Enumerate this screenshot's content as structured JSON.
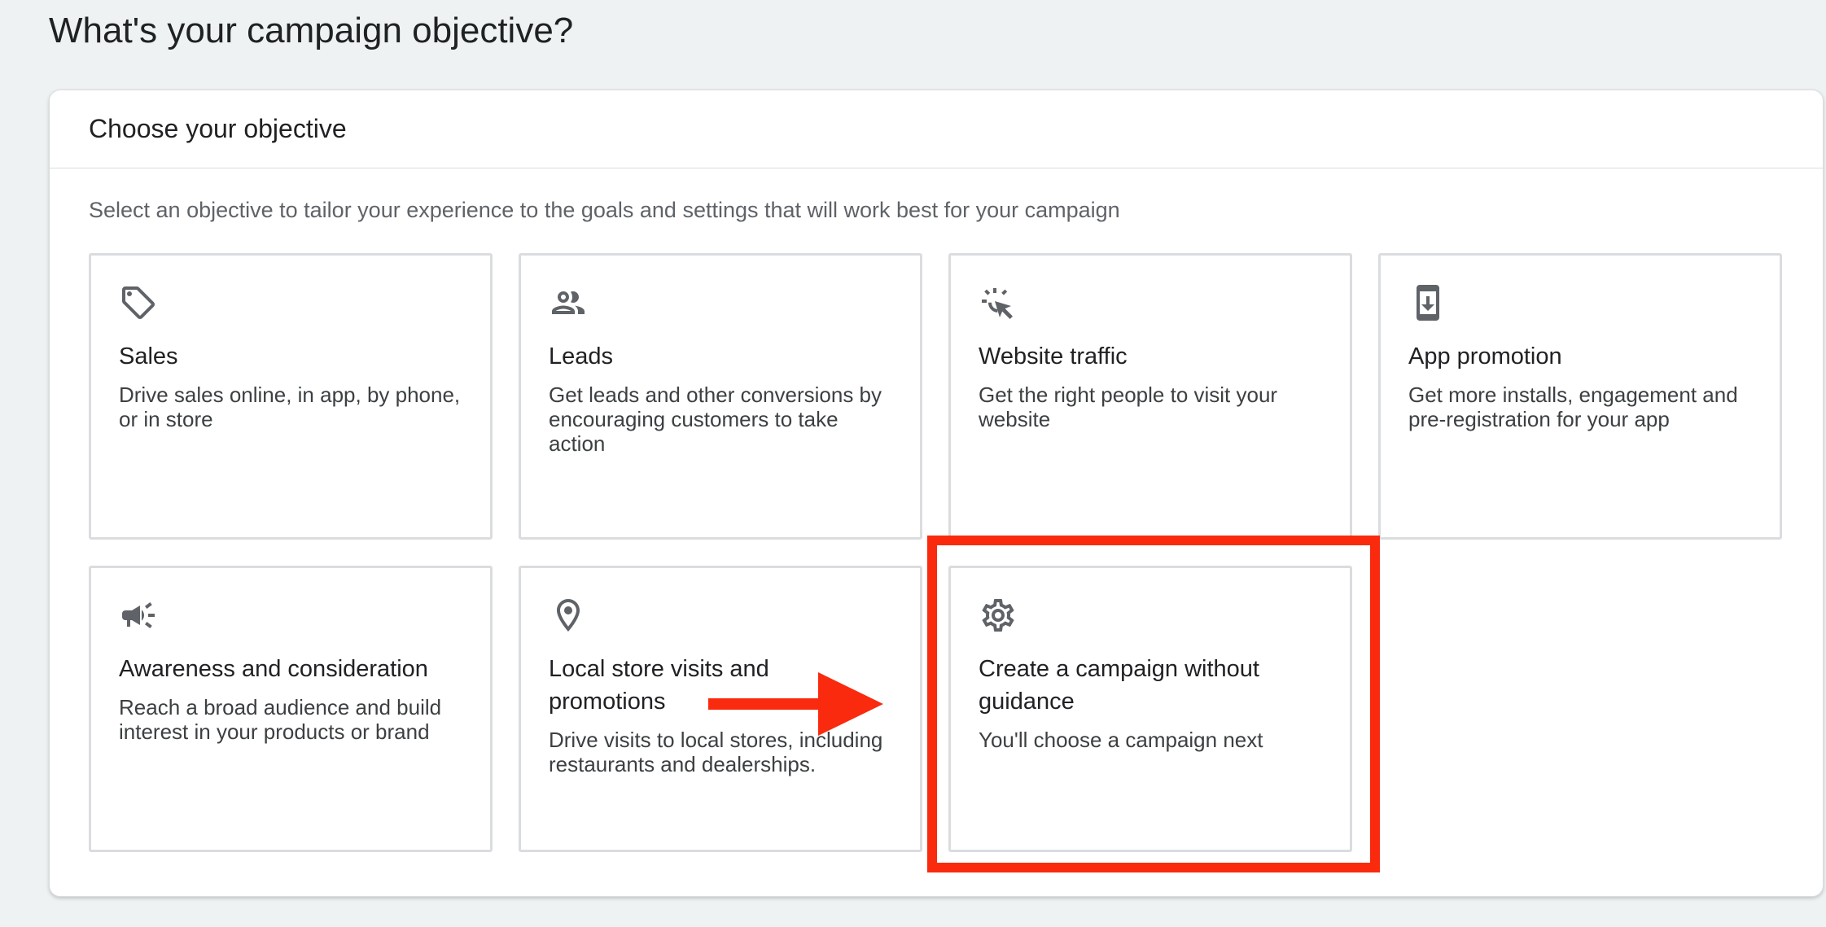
{
  "page": {
    "heading": "What's your campaign objective?"
  },
  "panel": {
    "title": "Choose your objective",
    "description": "Select an objective to tailor your experience to the goals and settings that will work best for your campaign"
  },
  "objectives": [
    {
      "title": "Sales",
      "description": "Drive sales online, in app, by phone, or in store",
      "icon": "tag-icon"
    },
    {
      "title": "Leads",
      "description": "Get leads and other conversions by encouraging customers to take action",
      "icon": "people-icon"
    },
    {
      "title": "Website traffic",
      "description": "Get the right people to visit your website",
      "icon": "cursor-click-icon"
    },
    {
      "title": "App promotion",
      "description": "Get more installs, engagement and pre-registration for your app",
      "icon": "phone-download-icon"
    },
    {
      "title": "Awareness and consideration",
      "description": "Reach a broad audience and build interest in your products or brand",
      "icon": "megaphone-icon"
    },
    {
      "title": "Local store visits and promotions",
      "description": "Drive visits to local stores, including restaurants and dealerships.",
      "icon": "location-pin-icon"
    },
    {
      "title": "Create a campaign without guidance",
      "description": "You'll choose a campaign next",
      "icon": "gear-icon"
    }
  ],
  "annotation": {
    "color": "#fa2a0f"
  }
}
